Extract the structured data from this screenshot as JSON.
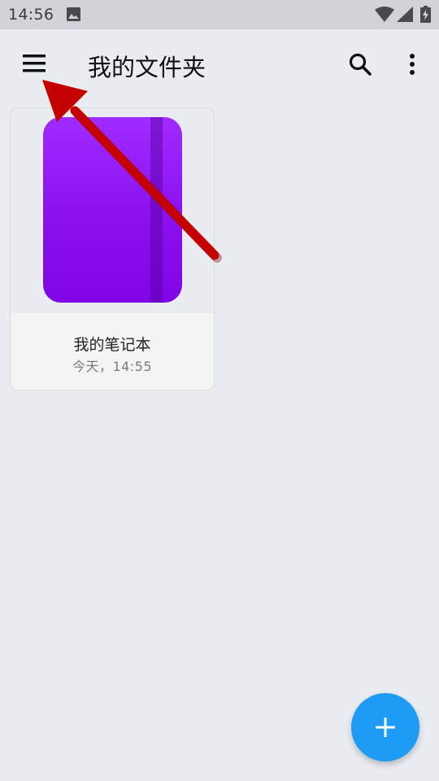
{
  "status_bar": {
    "time": "14:56",
    "icons": [
      "image-icon",
      "wifi-icon",
      "signal-icon",
      "battery-icon"
    ]
  },
  "app_bar": {
    "title": "我的文件夹",
    "icons": [
      "menu-icon",
      "search-icon",
      "more-vert-icon"
    ]
  },
  "notebooks": [
    {
      "name": "我的笔记本",
      "date": "今天，14:55",
      "cover_color": "#8a10ee"
    }
  ],
  "fab": {
    "icon": "plus-icon",
    "color": "#1e9bf5"
  },
  "annotation": {
    "type": "arrow",
    "color": "#c00000",
    "points_to": "menu-icon"
  }
}
